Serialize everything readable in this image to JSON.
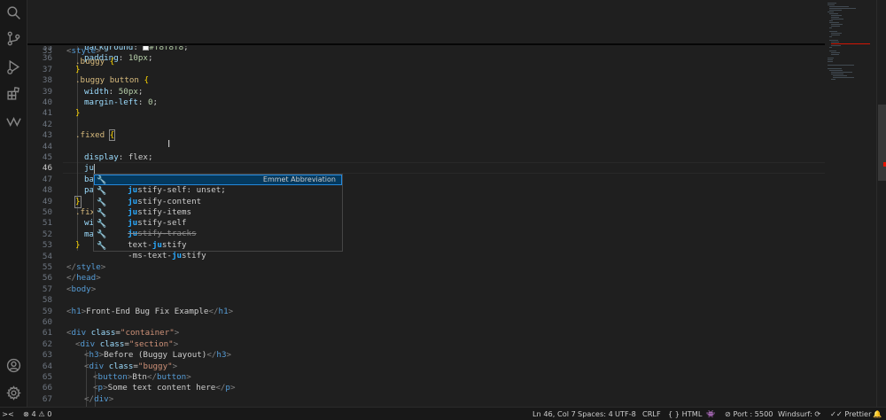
{
  "activity_bar": {
    "items": [
      "search-icon",
      "source-control-icon",
      "run-debug-icon",
      "extensions-icon",
      "windsurf-icon"
    ],
    "bottom": [
      "account-icon",
      "settings-gear-icon"
    ]
  },
  "sticky": [
    {
      "n": "2",
      "code": "<html lang=\"en\">"
    },
    {
      "n": "3",
      "code": "<head>"
    },
    {
      "n": "32",
      "code": "<style>"
    },
    {
      "n": "33",
      "code": ".buggy {"
    }
  ],
  "lines": [
    {
      "n": "35",
      "code": "background: #f8f8f8;"
    },
    {
      "n": "36",
      "code": "padding: 10px;"
    },
    {
      "n": "37",
      "code": "}"
    },
    {
      "n": "38",
      "code": ".buggy button {"
    },
    {
      "n": "39",
      "code": "width: 50px;"
    },
    {
      "n": "40",
      "code": "margin-left: 0;"
    },
    {
      "n": "41",
      "code": "}"
    },
    {
      "n": "42",
      "code": ""
    },
    {
      "n": "43",
      "code": ".fixed {"
    },
    {
      "n": "44",
      "code": ""
    },
    {
      "n": "45",
      "code": "display: flex;"
    },
    {
      "n": "46",
      "code": "ju"
    },
    {
      "n": "47",
      "code": "ba"
    },
    {
      "n": "48",
      "code": "pa"
    },
    {
      "n": "49",
      "code": "}"
    },
    {
      "n": "50",
      "code": ".fix"
    },
    {
      "n": "51",
      "code": "wi"
    },
    {
      "n": "52",
      "code": "ma"
    },
    {
      "n": "53",
      "code": "}"
    },
    {
      "n": "54",
      "code": ""
    },
    {
      "n": "55",
      "code": "</style>"
    },
    {
      "n": "56",
      "code": "</head>"
    },
    {
      "n": "57",
      "code": "<body>"
    },
    {
      "n": "58",
      "code": ""
    },
    {
      "n": "59",
      "code": "<h1>Front-End Bug Fix Example</h1>"
    },
    {
      "n": "60",
      "code": ""
    },
    {
      "n": "61",
      "code": "<div class=\"container\">"
    },
    {
      "n": "62",
      "code": "<div class=\"section\">"
    },
    {
      "n": "63",
      "code": "<h3>Before (Buggy Layout)</h3>"
    },
    {
      "n": "64",
      "code": "<div class=\"buggy\">"
    },
    {
      "n": "65",
      "code": "<button>Btn</button>"
    },
    {
      "n": "66",
      "code": "<p>Some text content here</p>"
    },
    {
      "n": "67",
      "code": "</div>"
    }
  ],
  "suggest": {
    "items": [
      {
        "text": "justify-self: unset;",
        "match": "ju",
        "detail": "Emmet Abbreviation"
      },
      {
        "text": "justify-content",
        "match": "ju"
      },
      {
        "text": "justify-items",
        "match": "ju"
      },
      {
        "text": "justify-self",
        "match": "ju"
      },
      {
        "text": "justify-tracks",
        "match": "ju",
        "deprecated": true
      },
      {
        "text": "text-justify",
        "match": "ju"
      },
      {
        "text": "-ms-text-justify",
        "match": "ju"
      }
    ]
  },
  "status_bar": {
    "remote_icon": "remote-icon",
    "errors": "4",
    "warnings": "0",
    "position": "Ln 46, Col 7",
    "spaces": "Spaces: 4",
    "encoding": "UTF-8",
    "eol": "CRLF",
    "language": "HTML",
    "port": "Port : 5500",
    "windsurf": "Windsurf:",
    "prettier": "Prettier"
  },
  "colors": {
    "accent": "#2488db",
    "selection": "#04395e",
    "error": "#e51400"
  }
}
